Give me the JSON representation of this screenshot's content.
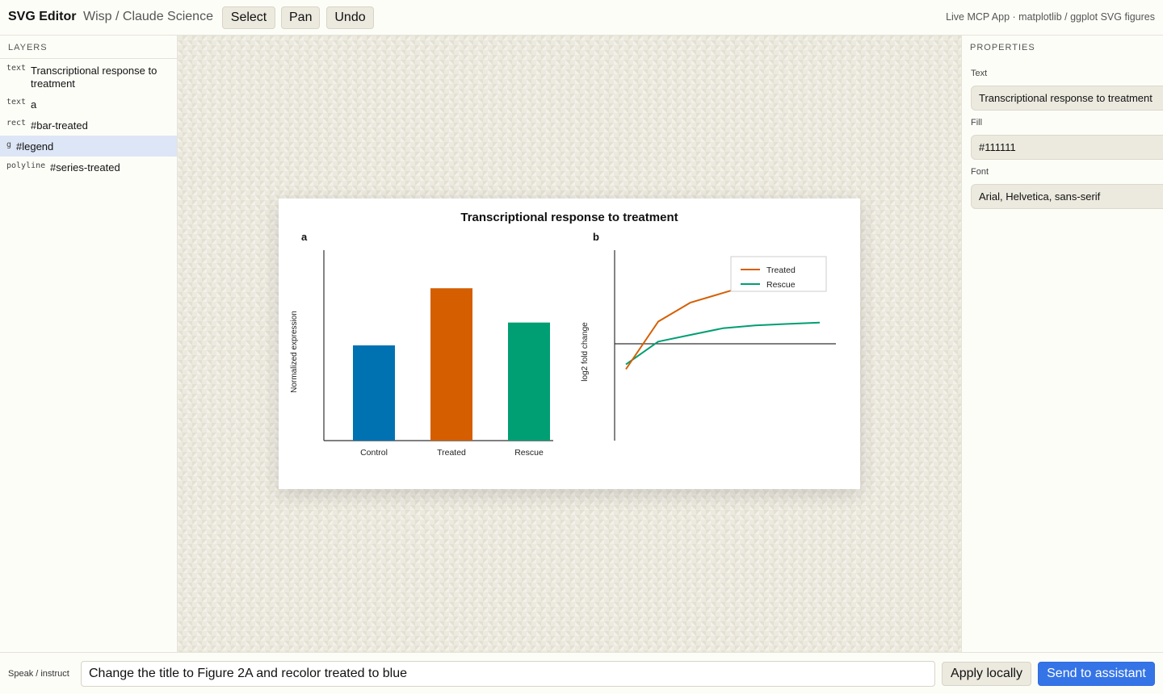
{
  "header": {
    "app_title": "SVG Editor",
    "breadcrumb": "Wisp / Claude Science",
    "tools": [
      "Select",
      "Pan",
      "Undo"
    ],
    "info": "Live MCP App · matplotlib / ggplot SVG figures"
  },
  "layers": {
    "heading": "LAYERS",
    "items": [
      {
        "type": "text",
        "name": "Transcriptional response to treatment",
        "selected": false
      },
      {
        "type": "text",
        "name": "a",
        "selected": false
      },
      {
        "type": "rect",
        "name": "#bar-treated",
        "selected": false
      },
      {
        "type": "g",
        "name": "#legend",
        "selected": true
      },
      {
        "type": "polyline",
        "name": "#series-treated",
        "selected": false
      }
    ]
  },
  "properties": {
    "heading": "PROPERTIES",
    "text_label": "Text",
    "text_value": "Transcriptional response to treatment",
    "fill_label": "Fill",
    "fill_value": "#111111",
    "font_label": "Font",
    "font_value": "Arial, Helvetica, sans-serif"
  },
  "bottom": {
    "speak_label": "Speak / instruct",
    "instruction": "Change the title to Figure 2A and recolor treated to blue",
    "apply_label": "Apply locally",
    "send_label": "Send to assistant"
  },
  "colors": {
    "accent": "#3574e6",
    "control": "#0072b2",
    "treated": "#d55e00",
    "rescue": "#009e73"
  },
  "chart_data": {
    "title": "Transcriptional response to treatment",
    "panels": [
      {
        "label": "a",
        "type": "bar",
        "ylabel": "Normalized expression",
        "categories": [
          "Control",
          "Treated",
          "Rescue"
        ],
        "values": [
          1.0,
          1.6,
          1.24
        ],
        "colors": [
          "#0072b2",
          "#d55e00",
          "#009e73"
        ],
        "ylim": [
          0,
          2.0
        ]
      },
      {
        "label": "b",
        "type": "line",
        "ylabel": "log2 fold change",
        "x": [
          0,
          1,
          2,
          3,
          4,
          5,
          6
        ],
        "ylim": [
          -2.0,
          2.0
        ],
        "series": [
          {
            "name": "Treated",
            "color": "#d55e00",
            "values": [
              -0.5,
              0.5,
              0.9,
              1.1,
              1.3,
              1.45,
              1.5
            ]
          },
          {
            "name": "Rescue",
            "color": "#009e73",
            "values": [
              -0.4,
              0.08,
              0.22,
              0.36,
              0.42,
              0.45,
              0.48
            ]
          }
        ],
        "legend_position": "top-right"
      }
    ]
  }
}
